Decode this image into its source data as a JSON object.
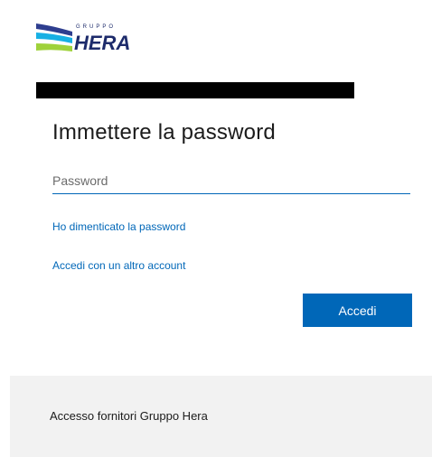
{
  "brand": {
    "logo_small_text": "GRUPPO",
    "logo_text": "HERA",
    "colors": {
      "stripe_top": "#2e3e8f",
      "stripe_middle": "#17b0e4",
      "stripe_bottom": "#9fd23b",
      "wordmark": "#1d2b6b"
    }
  },
  "login": {
    "title": "Immettere la password",
    "password_placeholder": "Password",
    "password_value": "",
    "forgot_password_link": "Ho dimenticato la password",
    "other_account_link": "Accedi con un altro account",
    "signin_button": "Accedi"
  },
  "footer": {
    "text": "Accesso fornitori Gruppo Hera"
  },
  "theme": {
    "accent": "#0067b8",
    "footer_background": "#f2f2f2",
    "redaction": "#000000"
  }
}
